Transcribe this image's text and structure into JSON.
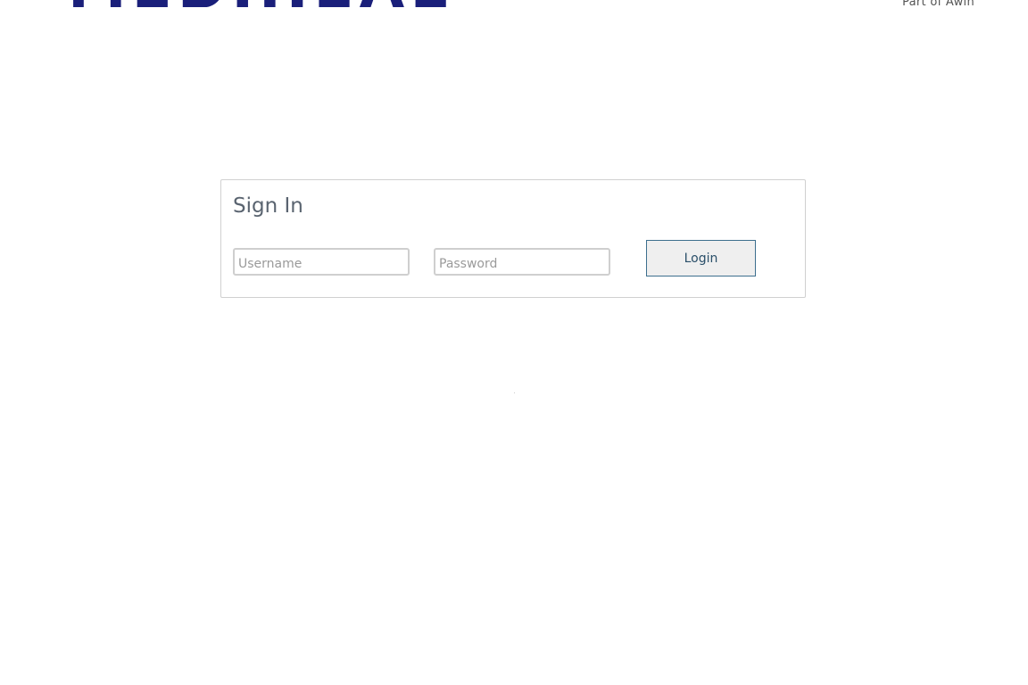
{
  "header": {
    "logo_text": "MEDIHEAL",
    "tagline": "Part of Awin"
  },
  "signin": {
    "title": "Sign In",
    "username_placeholder": "Username",
    "username_value": "",
    "password_placeholder": "Password",
    "password_value": "",
    "login_label": "Login"
  },
  "colors": {
    "logo": "#1a1f7a",
    "button_border": "#3d6f8e",
    "button_text": "#2a4f69"
  }
}
